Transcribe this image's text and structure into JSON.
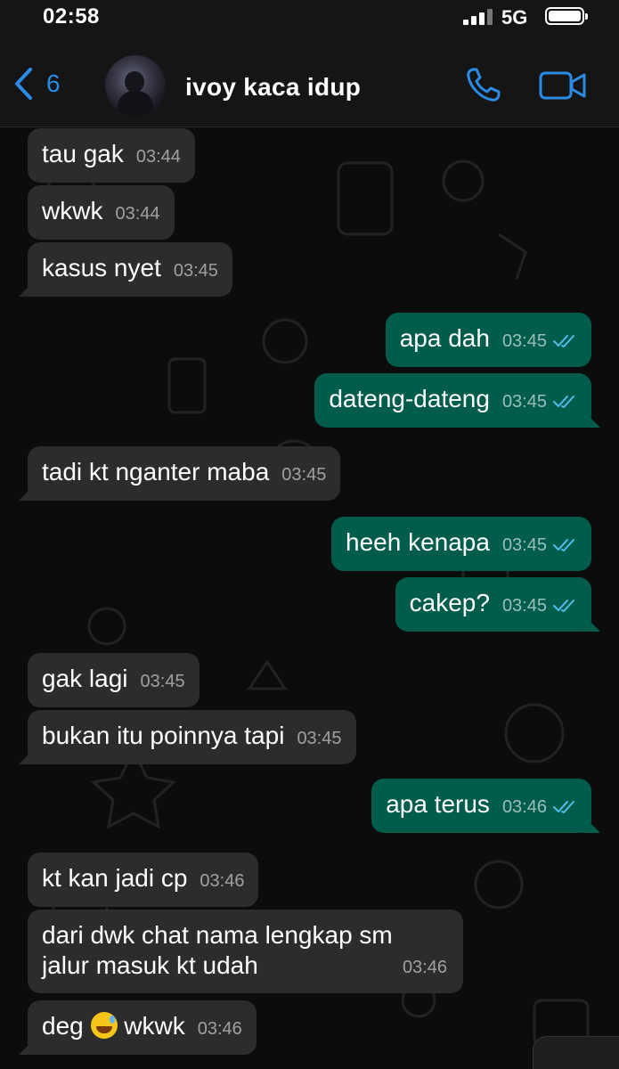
{
  "status_bar": {
    "time": "02:58",
    "network": "5G"
  },
  "header": {
    "unread_count": "6",
    "contact_name": "ivoy kaca idup"
  },
  "colors": {
    "accent": "#2b8ce8",
    "outgoing_bubble": "#005c4b",
    "incoming_bubble": "#2c2c2e",
    "read_ticks": "#53bdeb"
  },
  "messages": [
    {
      "dir": "in",
      "text": "tau gak",
      "time": "03:44"
    },
    {
      "dir": "in",
      "text": "wkwk",
      "time": "03:44"
    },
    {
      "dir": "in",
      "text": "kasus nyet",
      "time": "03:45"
    },
    {
      "dir": "out",
      "text": "apa dah",
      "time": "03:45",
      "status": "read"
    },
    {
      "dir": "out",
      "text": "dateng-dateng",
      "time": "03:45",
      "status": "read"
    },
    {
      "dir": "in",
      "text": "tadi kt nganter maba",
      "time": "03:45"
    },
    {
      "dir": "out",
      "text": "heeh kenapa",
      "time": "03:45",
      "status": "read"
    },
    {
      "dir": "out",
      "text": "cakep?",
      "time": "03:45",
      "status": "read"
    },
    {
      "dir": "in",
      "text": "gak lagi",
      "time": "03:45"
    },
    {
      "dir": "in",
      "text": "bukan itu poinnya tapi",
      "time": "03:45"
    },
    {
      "dir": "out",
      "text": "apa terus",
      "time": "03:46",
      "status": "read"
    },
    {
      "dir": "in",
      "text": "kt kan jadi cp",
      "time": "03:46"
    },
    {
      "dir": "in",
      "text": "dari dwk chat nama lengkap sm jalur masuk kt udah",
      "line1": "dari dwk chat nama lengkap sm",
      "line2": "jalur masuk kt udah",
      "time": "03:46"
    },
    {
      "dir": "in",
      "text_before": "deg",
      "emoji": "grinning-face-with-sweat",
      "text_after": "wkwk",
      "time": "03:46"
    }
  ]
}
